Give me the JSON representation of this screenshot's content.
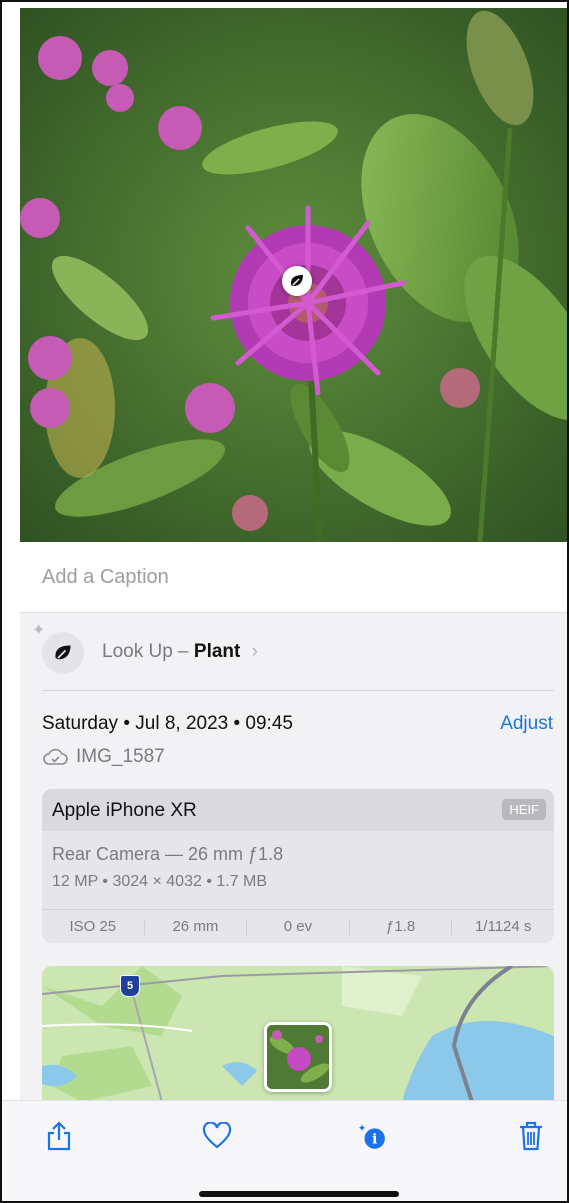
{
  "photo": {
    "subject": "flower",
    "badge_icon": "leaf-icon"
  },
  "caption": {
    "placeholder": "Add a Caption"
  },
  "lookup": {
    "prefix": "Look Up –",
    "subject": "Plant",
    "chevron": "›"
  },
  "metadata": {
    "date": "Saturday • Jul 8, 2023 • 09:45",
    "adjust_label": "Adjust",
    "filename": "IMG_1587"
  },
  "camera": {
    "device": "Apple iPhone XR",
    "format": "HEIF",
    "lens": "Rear Camera — 26 mm ƒ1.8",
    "specs": "12 MP • 3024 × 4032 • 1.7 MB",
    "exif": {
      "iso": "ISO 25",
      "focal": "26 mm",
      "ev": "0 ev",
      "aperture": "ƒ1.8",
      "shutter": "1/1124 s"
    }
  },
  "map": {
    "route_number": "5"
  },
  "toolbar": {
    "share": "share-icon",
    "favorite": "heart-icon",
    "info": "info-sparkle-icon",
    "delete": "trash-icon"
  },
  "colors": {
    "accent": "#1976d8",
    "info_active": "#1a73e8"
  }
}
